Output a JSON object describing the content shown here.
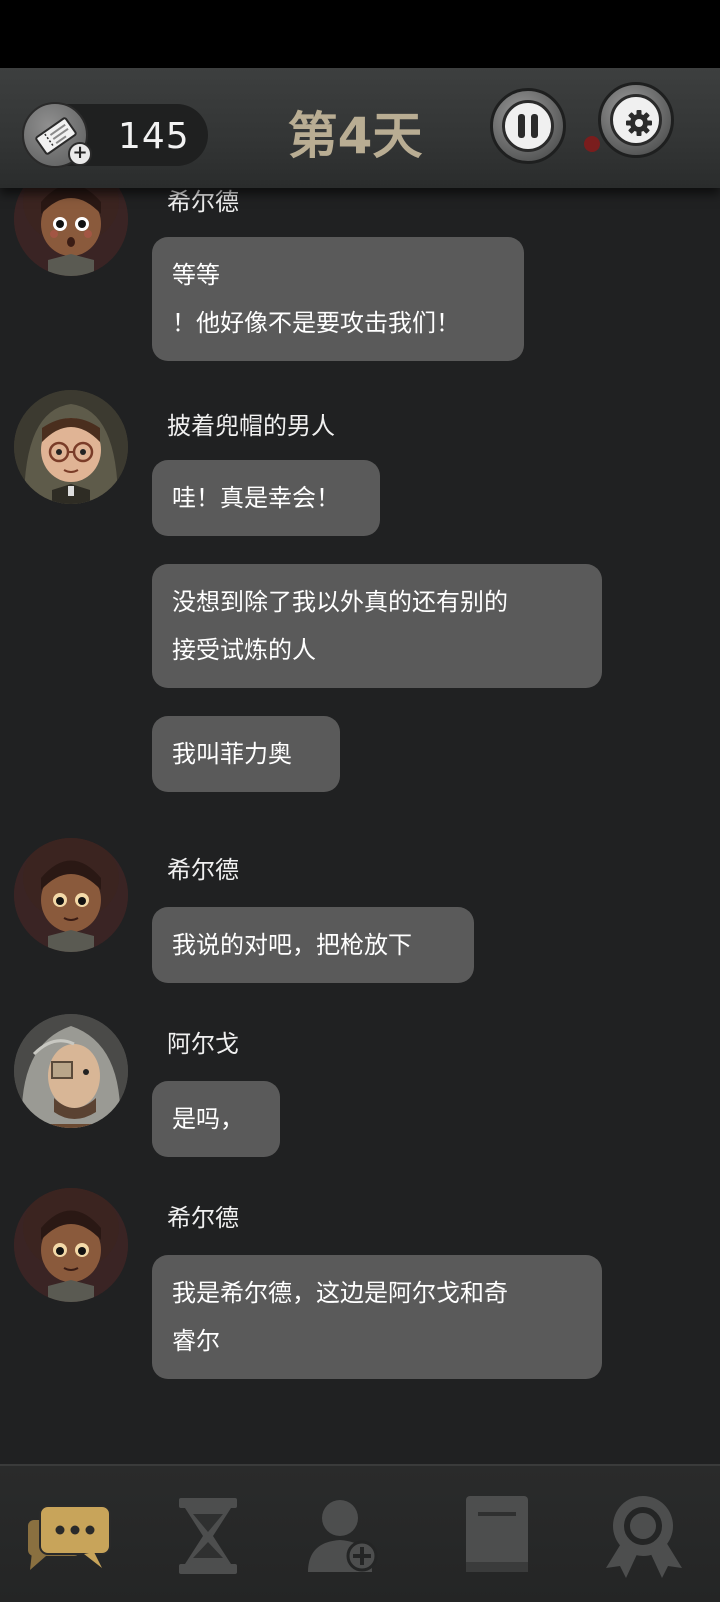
{
  "header": {
    "ticket_count": "145",
    "day_title": "第4天",
    "pause_icon": "pause-icon",
    "settings_icon": "gear-icon",
    "ticket_icon": "ticket-icon"
  },
  "messages": [
    {
      "speaker": "希尔德",
      "lines": [
        "等等",
        "！他好像不是要攻击我们！"
      ]
    },
    {
      "speaker": "披着兜帽的男人",
      "lines": [
        "哇！真是幸会！"
      ]
    },
    {
      "speaker": "",
      "lines": [
        "没想到除了我以外真的还有别的",
        "接受试炼的人"
      ]
    },
    {
      "speaker": "",
      "lines": [
        "我叫菲力奥"
      ]
    },
    {
      "speaker": "希尔德",
      "lines": [
        "我说的对吧，把枪放下"
      ]
    },
    {
      "speaker": "阿尔戈",
      "lines": [
        "是吗，"
      ]
    },
    {
      "speaker": "希尔德",
      "lines": [
        "我是希尔德，这边是阿尔戈和奇",
        "睿尔"
      ]
    }
  ],
  "bottom_nav": [
    {
      "icon": "chat-icon",
      "active": true
    },
    {
      "icon": "hourglass-icon",
      "active": false
    },
    {
      "icon": "add-contact-icon",
      "active": false
    },
    {
      "icon": "book-icon",
      "active": false
    },
    {
      "icon": "award-icon",
      "active": false
    }
  ],
  "colors": {
    "background": "#202122",
    "bubble": "#5a5a5a",
    "day_title": "#b9ad93",
    "active_nav": "#c8a45a",
    "inactive_nav": "#4d4e4e"
  }
}
